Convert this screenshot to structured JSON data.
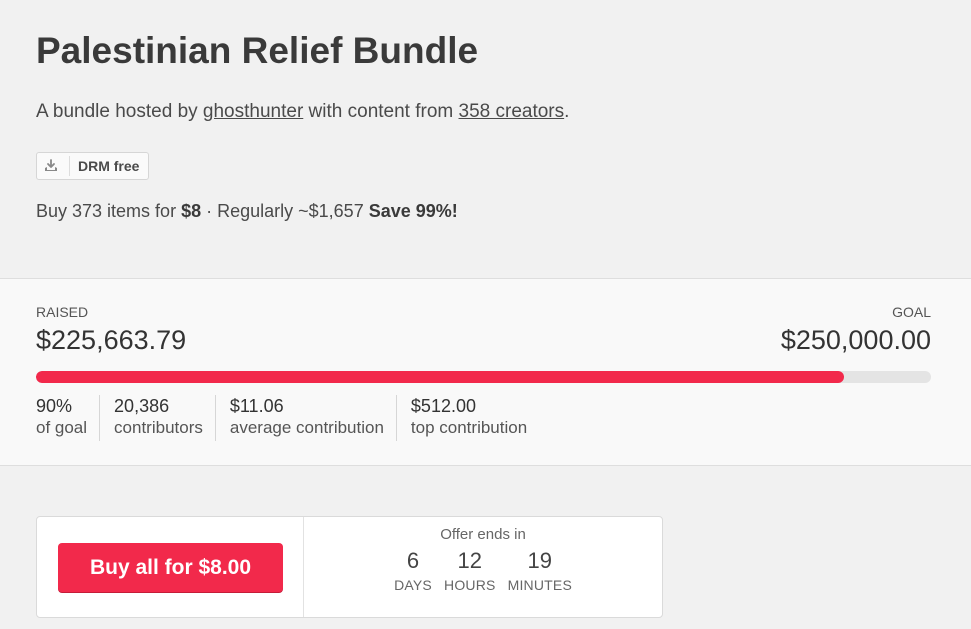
{
  "header": {
    "title": "Palestinian Relief Bundle",
    "byline_prefix": "A bundle hosted by ",
    "host": "ghosthunter",
    "byline_mid": " with content from ",
    "creators": "358 creators",
    "byline_suffix": ".",
    "drm_label": "DRM free",
    "drm_icon": "download-icon",
    "pricing_prefix": "Buy 373 items for ",
    "price": "$8",
    "pricing_mid": " · Regularly ~$1,657 ",
    "savings": "Save 99%!"
  },
  "stats": {
    "raised_label": "RAISED",
    "raised_amount": "$225,663.79",
    "goal_label": "GOAL",
    "goal_amount": "$250,000.00",
    "progress_fraction": 0.9027,
    "bar_color": "#f2294b",
    "metrics": [
      {
        "value": "90%",
        "label": "of goal"
      },
      {
        "value": "20,386",
        "label": "contributors"
      },
      {
        "value": "$11.06",
        "label": "average contribution"
      },
      {
        "value": "$512.00",
        "label": "top contribution"
      }
    ]
  },
  "buy": {
    "button_label": "Buy all for $8.00",
    "button_color": "#f2294b",
    "countdown_label": "Offer ends in",
    "countdown": [
      {
        "value": "6",
        "unit": "DAYS"
      },
      {
        "value": "12",
        "unit": "HOURS"
      },
      {
        "value": "19",
        "unit": "MINUTES"
      }
    ]
  }
}
